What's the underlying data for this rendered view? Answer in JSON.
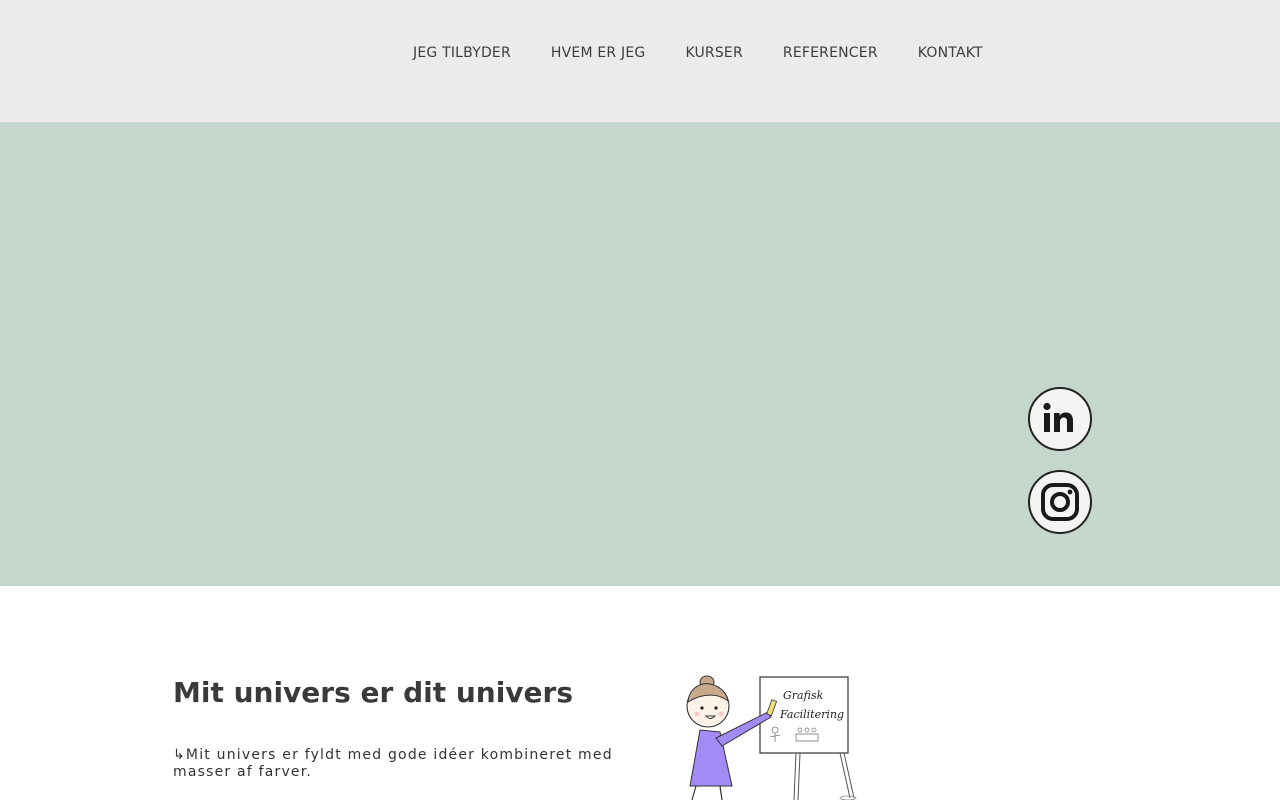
{
  "nav": {
    "items": [
      {
        "label": "JEG TILBYDER"
      },
      {
        "label": "HVEM ER JEG"
      },
      {
        "label": "KURSER"
      },
      {
        "label": "REFERENCER"
      },
      {
        "label": "KONTAKT"
      }
    ]
  },
  "hero": {
    "background": "#c5d6cc",
    "social": [
      {
        "name": "linkedin-icon"
      },
      {
        "name": "instagram-icon"
      }
    ]
  },
  "section": {
    "title": "Mit univers er dit univers",
    "body": "↳Mit univers er fyldt med gode idéer kombineret med masser af farver."
  },
  "illustration": {
    "board_line1": "Grafisk",
    "board_line2": "Facilitering"
  },
  "colors": {
    "header_bg": "#ebebeb",
    "hero_bg": "#c5d6cc",
    "figure_dress": "#a38bf5"
  }
}
